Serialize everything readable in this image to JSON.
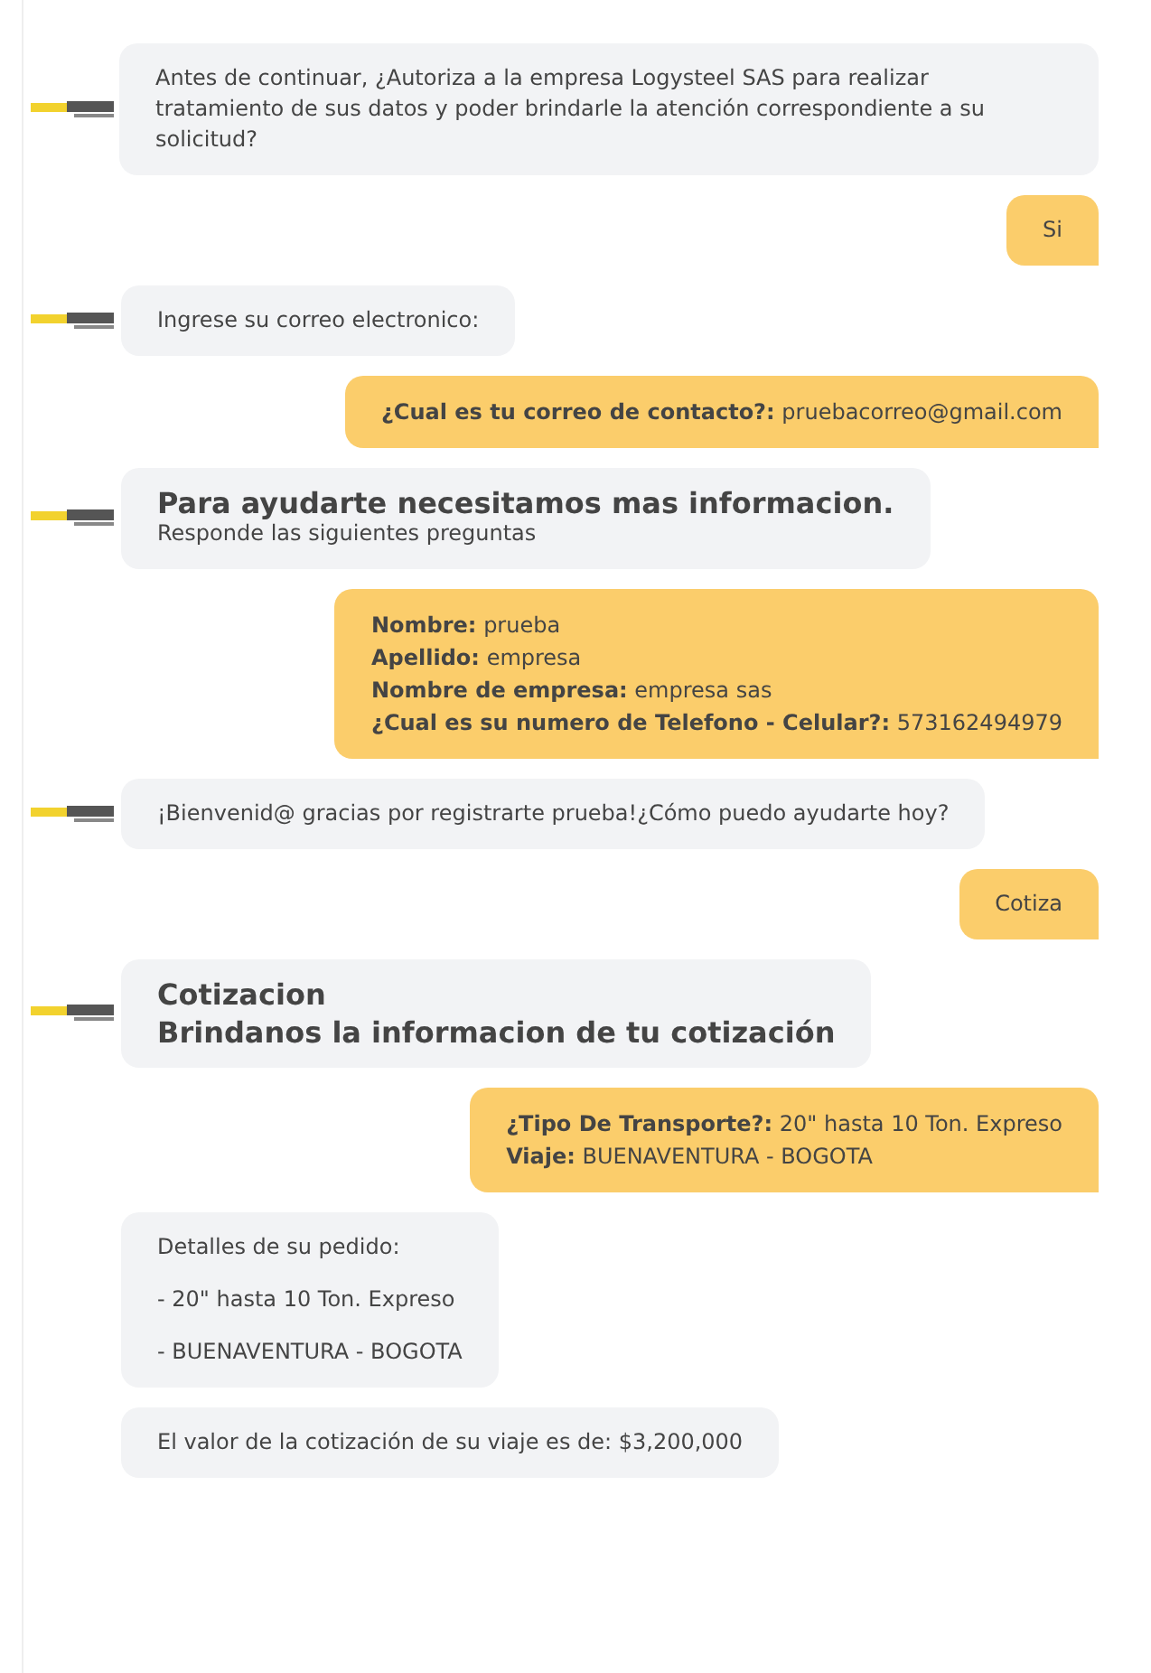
{
  "messages": [
    {
      "kind": "bot_text",
      "avatar": true,
      "text": "Antes de continuar, ¿Autoriza a la empresa Logysteel SAS para realizar tratamiento de sus datos y poder brindarle la atención correspondiente a su solicitud?"
    },
    {
      "kind": "user_text",
      "text": "Si"
    },
    {
      "kind": "bot_text",
      "avatar": true,
      "text": "Ingrese su correo electronico:"
    },
    {
      "kind": "user_fields",
      "fields": [
        {
          "label": "¿Cual es tu correo de contacto?:",
          "value": "pruebacorreo@gmail.com"
        }
      ]
    },
    {
      "kind": "bot_heading",
      "avatar": true,
      "title": "Para ayudarte necesitamos mas informacion.",
      "subtitle": "Responde las siguientes preguntas"
    },
    {
      "kind": "user_fields",
      "fields": [
        {
          "label": "Nombre:",
          "value": "prueba"
        },
        {
          "label": "Apellido:",
          "value": "empresa"
        },
        {
          "label": "Nombre de empresa:",
          "value": "empresa sas"
        },
        {
          "label": "¿Cual es su numero de Telefono - Celular?:",
          "value": "573162494979"
        }
      ]
    },
    {
      "kind": "bot_text",
      "avatar": true,
      "text": "¡Bienvenid@ gracias por registrarte prueba!¿Cómo puedo ayudarte hoy?"
    },
    {
      "kind": "user_text",
      "text": "Cotiza"
    },
    {
      "kind": "bot_titles",
      "avatar": true,
      "lines": [
        "Cotizacion",
        "Brindanos la informacion de tu cotización"
      ]
    },
    {
      "kind": "user_fields",
      "fields": [
        {
          "label": "¿Tipo De Transporte?:",
          "value": "20\" hasta 10 Ton. Expreso"
        },
        {
          "label": "Viaje:",
          "value": "BUENAVENTURA - BOGOTA"
        }
      ]
    },
    {
      "kind": "bot_list",
      "avatar": false,
      "items": [
        "Detalles de su pedido:",
        "- 20\" hasta 10 Ton. Expreso",
        "- BUENAVENTURA - BOGOTA"
      ]
    },
    {
      "kind": "bot_text",
      "avatar": false,
      "text": "El valor de la cotización de su viaje es de: $3,200,000"
    }
  ]
}
